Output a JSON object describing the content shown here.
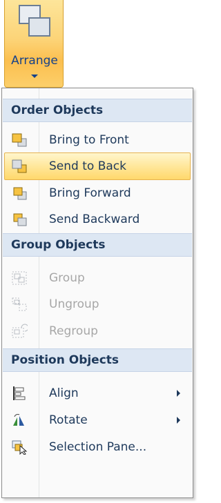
{
  "ribbon": {
    "label": "Arrange"
  },
  "menu": {
    "sections": [
      {
        "header": "Order Objects",
        "items": [
          {
            "label": "Bring to Front",
            "icon": "bring-to-front-icon"
          },
          {
            "label": "Send to Back",
            "icon": "send-to-back-icon",
            "state": "highlighted"
          },
          {
            "label": "Bring Forward",
            "icon": "bring-forward-icon"
          },
          {
            "label": "Send Backward",
            "icon": "send-backward-icon"
          }
        ]
      },
      {
        "header": "Group Objects",
        "items": [
          {
            "label": "Group",
            "icon": "group-icon",
            "state": "disabled"
          },
          {
            "label": "Ungroup",
            "icon": "ungroup-icon",
            "state": "disabled"
          },
          {
            "label": "Regroup",
            "icon": "regroup-icon",
            "state": "disabled"
          }
        ]
      },
      {
        "header": "Position Objects",
        "items": [
          {
            "label": "Align",
            "icon": "align-icon",
            "submenu": true
          },
          {
            "label": "Rotate",
            "icon": "rotate-icon",
            "submenu": true
          },
          {
            "label": "Selection Pane...",
            "icon": "selection-pane-icon"
          }
        ]
      }
    ]
  },
  "colors": {
    "text": "#1e395b",
    "disabled_text": "#a7a7a7",
    "header_bg": "#dde7f3",
    "highlight": "#ffe79b",
    "ribbon_button": "#fcd478"
  }
}
